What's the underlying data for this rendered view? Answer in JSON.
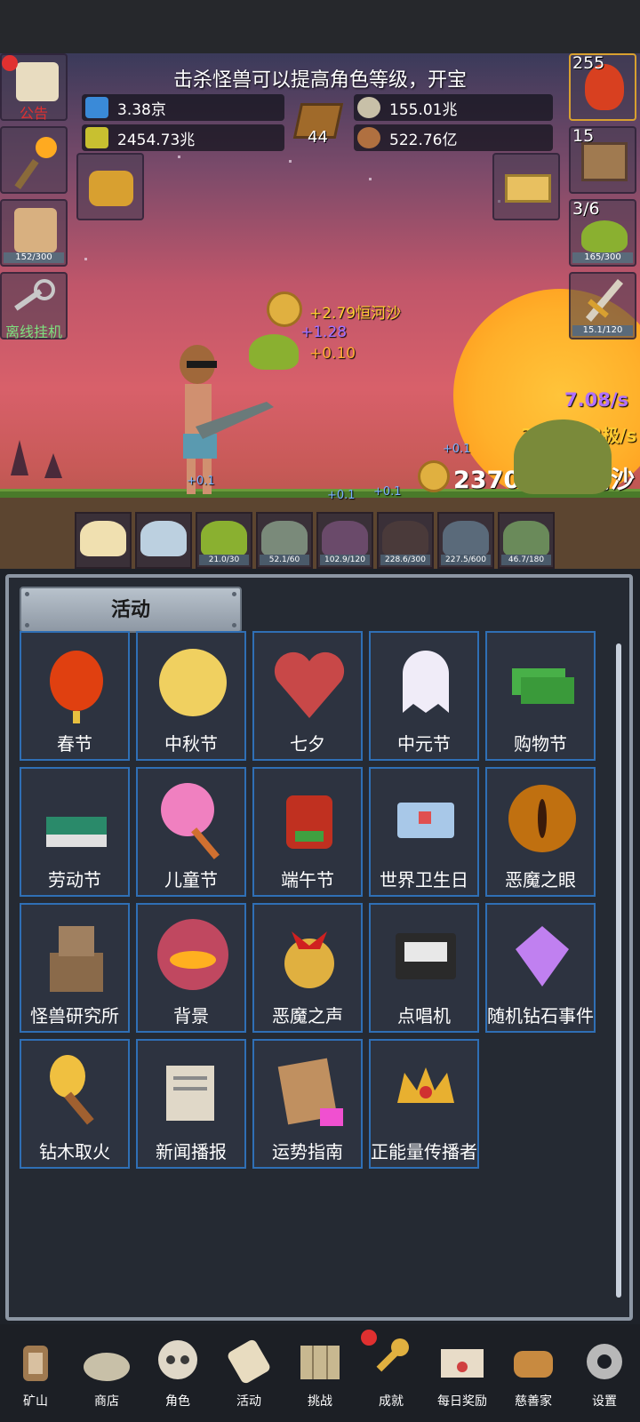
{
  "header": {
    "banner": "击杀怪兽可以提高角色等级，开宝"
  },
  "resources": {
    "blue_potion": "3.38京",
    "yellow_potion": "2454.73兆",
    "book_count": "44",
    "silver_coin": "155.01兆",
    "meat": "522.76亿"
  },
  "left_tiles": {
    "notice_label": "公告",
    "drink_progress": "152/300",
    "offline_label": "离线挂机"
  },
  "right_tiles": {
    "potion_count": "255",
    "chest_count": "15",
    "slime_count": "3/6",
    "slime_progress": "165/300",
    "sword_progress": "15.1/120"
  },
  "floating": {
    "gain_gold": "+2.79恒河沙",
    "gain_blue": "+1.28",
    "gain_orange": "+0.10",
    "rate_purple": "7.08/s",
    "rate_gold": "3381.78极/s",
    "total_gold": "2370.80恒河沙",
    "small_1": "+0.1",
    "small_2": "+0.1",
    "small_3": "+0.1",
    "small_4": "+0.1"
  },
  "monster_slots": [
    {
      "name": "candle",
      "progress": ""
    },
    {
      "name": "egg",
      "progress": ""
    },
    {
      "name": "green-slime",
      "progress": "21.0/30"
    },
    {
      "name": "gray-blob",
      "progress": "52.1/60"
    },
    {
      "name": "bat",
      "progress": "102.9/120"
    },
    {
      "name": "spider",
      "progress": "228.6/300"
    },
    {
      "name": "hooded",
      "progress": "227.5/600"
    },
    {
      "name": "goblin",
      "progress": "46.7/180"
    }
  ],
  "panel": {
    "title": "活动",
    "items": [
      {
        "label": "春节",
        "icon": "lantern-icon"
      },
      {
        "label": "中秋节",
        "icon": "moon-icon"
      },
      {
        "label": "七夕",
        "icon": "heart-icon"
      },
      {
        "label": "中元节",
        "icon": "ghost-icon"
      },
      {
        "label": "购物节",
        "icon": "cash-icon"
      },
      {
        "label": "劳动节",
        "icon": "brush-icon"
      },
      {
        "label": "儿童节",
        "icon": "lollipop-icon"
      },
      {
        "label": "端午节",
        "icon": "dragon-mask-icon"
      },
      {
        "label": "世界卫生日",
        "icon": "ambulance-icon"
      },
      {
        "label": "恶魔之眼",
        "icon": "eye-icon"
      },
      {
        "label": "怪兽研究所",
        "icon": "lab-icon"
      },
      {
        "label": "背景",
        "icon": "sunset-icon"
      },
      {
        "label": "恶魔之声",
        "icon": "bell-icon"
      },
      {
        "label": "点唱机",
        "icon": "cassette-icon"
      },
      {
        "label": "随机钻石事件",
        "icon": "diamond-icon"
      },
      {
        "label": "钻木取火",
        "icon": "torch-icon"
      },
      {
        "label": "新闻播报",
        "icon": "news-icon"
      },
      {
        "label": "运势指南",
        "icon": "fortune-icon"
      },
      {
        "label": "正能量传播者",
        "icon": "crown-icon"
      }
    ]
  },
  "nav": [
    {
      "label": "矿山",
      "icon": "lantern-icon"
    },
    {
      "label": "商店",
      "icon": "coin-pile-icon"
    },
    {
      "label": "角色",
      "icon": "skull-icon"
    },
    {
      "label": "活动",
      "icon": "scroll-icon"
    },
    {
      "label": "挑战",
      "icon": "map-icon"
    },
    {
      "label": "成就",
      "icon": "key-icon"
    },
    {
      "label": "每日奖励",
      "icon": "letter-icon"
    },
    {
      "label": "慈善家",
      "icon": "bread-icon"
    },
    {
      "label": "设置",
      "icon": "gear-icon"
    }
  ],
  "colors": {
    "panel_bg": "#252a33",
    "tile_border": "#2f6fb5",
    "gold_text": "#ffcc33",
    "purple_text": "#b070ff"
  }
}
